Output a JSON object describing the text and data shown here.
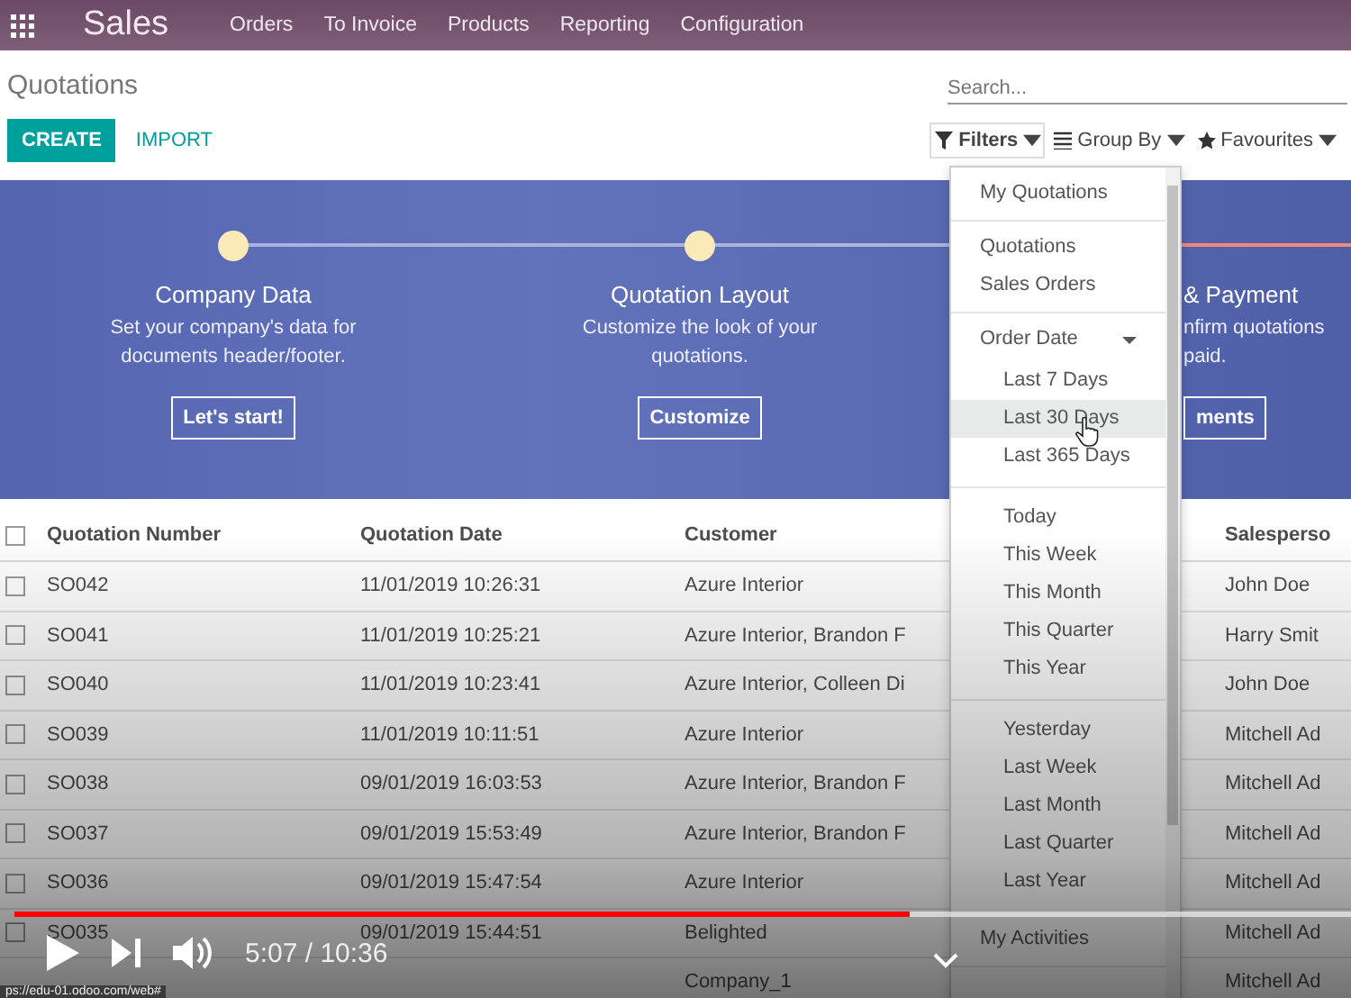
{
  "navbar": {
    "app": "Sales",
    "menu": [
      "Orders",
      "To Invoice",
      "Products",
      "Reporting",
      "Configuration"
    ]
  },
  "control_panel": {
    "title": "Quotations",
    "search": {
      "placeholder": "Search..."
    },
    "buttons": [
      {
        "label": "CREATE",
        "kind": "primary"
      },
      {
        "label": "IMPORT",
        "kind": "link"
      }
    ],
    "search_options": [
      {
        "label": "Filters",
        "kind": "filter",
        "open": true
      },
      {
        "label": "Group By",
        "kind": "group"
      },
      {
        "label": "Favourites",
        "kind": "star"
      }
    ]
  },
  "banner": {
    "steps": [
      {
        "kind": "full",
        "title": "Company Data",
        "description": "Set your company's data for documents header/footer.",
        "button": "Let's start!"
      },
      {
        "kind": "full",
        "title": "Quotation Layout",
        "description": "Customize the look of your quotations.",
        "button": "Customize"
      },
      {
        "kind": "clipped",
        "title": "& Payment",
        "description": [
          "nfirm quotations",
          "paid."
        ],
        "button": "ments"
      }
    ]
  },
  "table": {
    "columns": [
      "Quotation Number",
      "Quotation Date",
      "Customer",
      "Salesperso"
    ],
    "header_checked": false,
    "rows": [
      {
        "checked": false,
        "number": "SO042",
        "date": "11/01/2019 10:26:31",
        "customer": "Azure Interior",
        "salesperson": "John Doe"
      },
      {
        "checked": false,
        "number": "SO041",
        "date": "11/01/2019 10:25:21",
        "customer": "Azure Interior, Brandon F",
        "salesperson": "Harry Smit"
      },
      {
        "checked": false,
        "number": "SO040",
        "date": "11/01/2019 10:23:41",
        "customer": "Azure Interior, Colleen Di",
        "salesperson": "John Doe"
      },
      {
        "checked": false,
        "number": "SO039",
        "date": "11/01/2019 10:11:51",
        "customer": "Azure Interior",
        "salesperson": "Mitchell Ad"
      },
      {
        "checked": false,
        "number": "SO038",
        "date": "09/01/2019 16:03:53",
        "customer": "Azure Interior, Brandon F",
        "salesperson": "Mitchell Ad"
      },
      {
        "checked": false,
        "number": "SO037",
        "date": "09/01/2019 15:53:49",
        "customer": "Azure Interior, Brandon F",
        "salesperson": "Mitchell Ad"
      },
      {
        "checked": false,
        "number": "SO036",
        "date": "09/01/2019 15:47:54",
        "customer": "Azure Interior",
        "salesperson": "Mitchell Ad"
      },
      {
        "checked": false,
        "number": "SO035",
        "date": "09/01/2019 15:44:51",
        "customer": "Belighted",
        "salesperson": "Mitchell Ad"
      },
      {
        "customer": "Company_1",
        "salesperson": "Mitchell Ad"
      }
    ]
  },
  "filter_menu": {
    "sections": [
      {
        "items": [
          {
            "label": "My Quotations",
            "selected": false
          }
        ]
      },
      {
        "items": [
          {
            "label": "Quotations",
            "selected": false
          },
          {
            "label": "Sales Orders",
            "selected": false
          }
        ]
      },
      {
        "group": {
          "label": "Order Date",
          "expanded": true,
          "sections": [
            {
              "items": [
                {
                  "label": "Last 7 Days",
                  "selected": false
                },
                {
                  "label": "Last 30 Days",
                  "selected": true
                },
                {
                  "label": "Last 365 Days",
                  "selected": false
                }
              ]
            },
            {
              "items": [
                {
                  "label": "Today",
                  "selected": false
                },
                {
                  "label": "This Week",
                  "selected": false
                },
                {
                  "label": "This Month",
                  "selected": false
                },
                {
                  "label": "This Quarter",
                  "selected": false
                },
                {
                  "label": "This Year",
                  "selected": false
                }
              ]
            },
            {
              "items": [
                {
                  "label": "Yesterday",
                  "selected": false
                },
                {
                  "label": "Last Week",
                  "selected": false
                },
                {
                  "label": "Last Month",
                  "selected": false
                },
                {
                  "label": "Last Quarter",
                  "selected": false
                },
                {
                  "label": "Last Year",
                  "selected": false
                }
              ]
            }
          ]
        }
      },
      {
        "items": [
          {
            "label": "My Activities",
            "selected": false
          }
        ]
      }
    ]
  },
  "video_player": {
    "playing": false,
    "level": 0.67,
    "time": "5:07 / 10:36",
    "status_url": "ps://edu-01.odoo.com/web#"
  }
}
